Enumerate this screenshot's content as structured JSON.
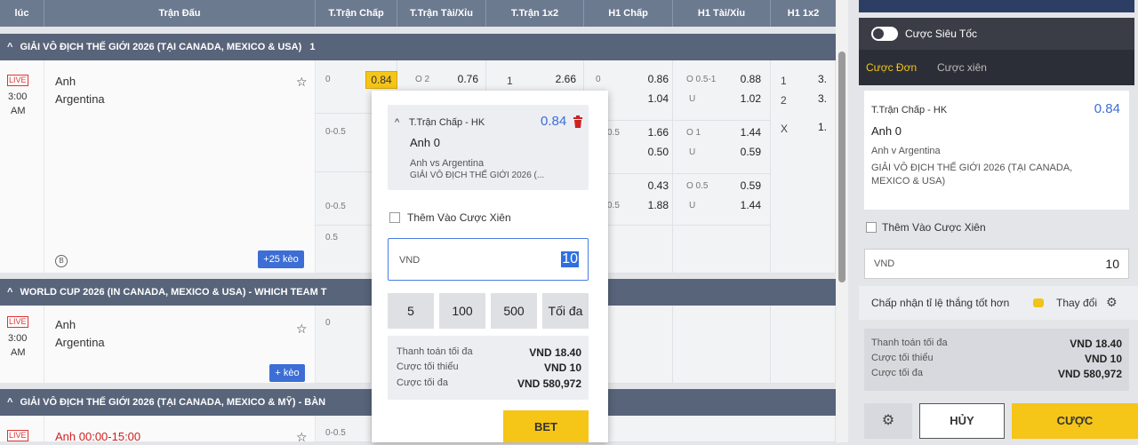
{
  "header": {
    "cols": [
      "lúc",
      "Trận Đấu",
      "T.Trận Chấp",
      "T.Trận Tài/Xỉu",
      "T.Trận 1x2",
      "H1 Chấp",
      "H1 Tài/Xỉu",
      "H1 1x2"
    ]
  },
  "leagues": [
    {
      "name": "GIẢI VÔ ĐỊCH THẾ GIỚI 2026 (TẠI CANADA, MEXICO & USA)",
      "count": "1"
    },
    {
      "name": "WORLD CUP 2026 (IN CANADA, MEXICO & USA) - WHICH TEAM T"
    },
    {
      "name": "GIẢI VÔ ĐỊCH THẾ GIỚI 2026 (TẠI CANADA, MEXICO & MỸ) - BÀN"
    }
  ],
  "match1": {
    "live": "LIVE",
    "time1": "3:00",
    "time2": "AM",
    "home": "Anh",
    "away": "Argentina",
    "b_icon": "B",
    "more": "+25 kèo",
    "ft_hdp": {
      "l1": "0",
      "o1": "0.84",
      "l2": "0-0.5",
      "l3": "0-0.5",
      "l4": "0.5"
    },
    "ft_ou": {
      "l1": "O 2",
      "o1": "0.76"
    },
    "ft_1x2": {
      "l1": "1",
      "o1": "2.66"
    },
    "h1_hdp": [
      {
        "l": "0",
        "o1": "0.86",
        "o2": "1.04"
      },
      {
        "l": "0.5",
        "o1": "1.66",
        "o2": "0.50"
      },
      {
        "l": "",
        "o1": "0.43",
        "o2": ""
      },
      {
        "l": "0.5",
        "o1": "1.88",
        "o2": ""
      }
    ],
    "h1_ou": [
      {
        "l1": "O 0.5-1",
        "o1": "0.88",
        "l2": "U",
        "o2": "1.02"
      },
      {
        "l1": "O 1",
        "o1": "1.44",
        "l2": "U",
        "o2": "0.59"
      },
      {
        "l1": "O 0.5",
        "o1": "0.59",
        "l2": "U",
        "o2": "1.44"
      }
    ],
    "h1_1x2": {
      "l1": "1",
      "o1": "3.",
      "l2": "2",
      "o2": "3.",
      "l3": "X",
      "o3": "1."
    }
  },
  "match2": {
    "live": "LIVE",
    "time1": "3:00",
    "time2": "AM",
    "home": "Anh",
    "away": "Argentina",
    "more": "+ kèo",
    "l1": "0"
  },
  "match3": {
    "live": "LIVE",
    "home": "Anh 00:00-15:00",
    "l1": "0-0.5"
  },
  "popup": {
    "market": "T.Trận Chấp - HK",
    "odds": "0.84",
    "selection": "Anh 0",
    "match": "Anh vs Argentina",
    "league": "GIẢI VÔ ĐỊCH THẾ GIỚI 2026 (...",
    "parlay": "Thêm Vào Cược Xiên",
    "currency": "VND",
    "stake": "10",
    "amounts": [
      "5",
      "100",
      "500",
      "Tối đa"
    ],
    "payout_label": "Thanh toán tối đa",
    "payout": "VND 18.40",
    "min_label": "Cược tối thiểu",
    "min": "VND 10",
    "max_label": "Cược tối đa",
    "max": "VND 580,972",
    "bet": "BET"
  },
  "slip": {
    "quick": "Cược Siêu Tốc",
    "tab_single": "Cược Đơn",
    "tab_parlay": "Cược xiên",
    "market": "T.Trận Chấp - HK",
    "odds": "0.84",
    "selection": "Anh 0",
    "match": "Anh v Argentina",
    "league": "GIẢI VÔ ĐỊCH THẾ GIỚI 2026 (TẠI CANADA, MEXICO & USA)",
    "parlay": "Thêm Vào Cược Xiên",
    "currency": "VND",
    "stake": "10",
    "accept": "Chấp nhận tỉ lệ thắng tốt hơn",
    "change": "Thay đổi",
    "payout_label": "Thanh toán tối đa",
    "payout": "VND 18.40",
    "min_label": "Cược tối thiểu",
    "min": "VND 10",
    "max_label": "Cược tối đa",
    "max": "VND 580,972",
    "cancel": "HỦY",
    "submit": "CƯỢC"
  },
  "colors": {
    "header": "#6c7a90",
    "league": "#58647a",
    "odds_highlight": "#f5c518",
    "bet_button": "#f5c518",
    "link_blue": "#3c6ed6",
    "live_red": "#d33"
  }
}
